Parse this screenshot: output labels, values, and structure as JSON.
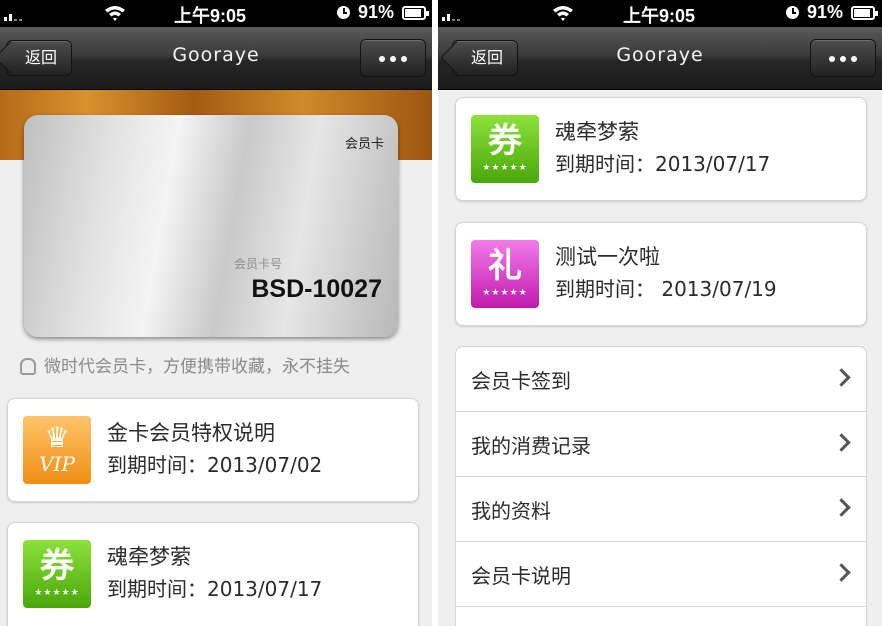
{
  "status_bar": {
    "time": "上午9:05",
    "battery": "91%"
  },
  "nav": {
    "back_label": "返回",
    "title": "Gooraye"
  },
  "card": {
    "label": "会员卡",
    "number_label": "会员卡号",
    "number": "BSD-10027"
  },
  "tagline": "微时代会员卡，方便携带收藏，永不挂失",
  "left_coupons": [
    {
      "title": "金卡会员特权说明",
      "date": "到期时间：2013/07/02",
      "icon": "vip-crown-icon",
      "glyph": "♛",
      "sub": "VIP"
    },
    {
      "title": "魂牵梦萦",
      "date": "到期时间：2013/07/17",
      "icon": "coupon-icon",
      "glyph": "券",
      "sub": "★★★★★"
    }
  ],
  "right_coupons": [
    {
      "title": "魂牵梦萦",
      "date": "到期时间：2013/07/17",
      "icon": "coupon-icon",
      "glyph": "券",
      "sub": "★★★★★"
    },
    {
      "title": "测试一次啦",
      "date": "到期时间： 2013/07/19",
      "icon": "gift-icon",
      "glyph": "礼",
      "sub": "★★★★★"
    }
  ],
  "menu": [
    {
      "label": "会员卡签到"
    },
    {
      "label": "我的消费记录"
    },
    {
      "label": "我的资料"
    },
    {
      "label": "会员卡说明"
    }
  ],
  "colors": {
    "green": "#6cc31f",
    "pink": "#e04ad3",
    "orange": "#f6a532",
    "navbar": "#2a2a2a"
  }
}
